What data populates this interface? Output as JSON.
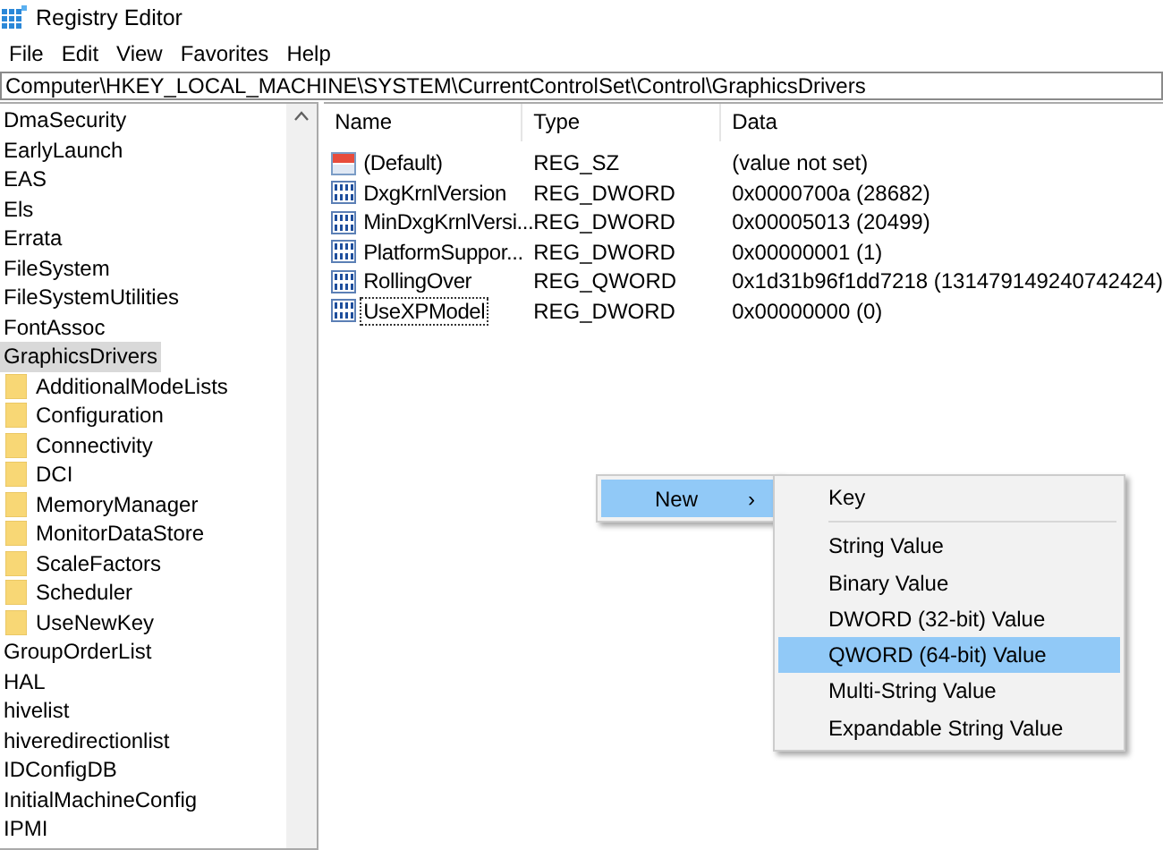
{
  "window": {
    "title": "Registry Editor"
  },
  "menu_bar": [
    "File",
    "Edit",
    "View",
    "Favorites",
    "Help"
  ],
  "address_bar": {
    "value": "Computer\\HKEY_LOCAL_MACHINE\\SYSTEM\\CurrentControlSet\\Control\\GraphicsDrivers"
  },
  "tree": [
    {
      "label": "DmaSecurity",
      "selected": false
    },
    {
      "label": "EarlyLaunch",
      "selected": false
    },
    {
      "label": "EAS",
      "selected": false
    },
    {
      "label": "Els",
      "selected": false
    },
    {
      "label": "Errata",
      "selected": false
    },
    {
      "label": "FileSystem",
      "selected": false
    },
    {
      "label": "FileSystemUtilities",
      "selected": false
    },
    {
      "label": "FontAssoc",
      "selected": false
    },
    {
      "label": "GraphicsDrivers",
      "selected": true,
      "children": [
        {
          "label": "AdditionalModeLists",
          "selected": false
        },
        {
          "label": "Configuration",
          "selected": false
        },
        {
          "label": "Connectivity",
          "selected": false
        },
        {
          "label": "DCI",
          "selected": false
        },
        {
          "label": "MemoryManager",
          "selected": false
        },
        {
          "label": "MonitorDataStore",
          "selected": false
        },
        {
          "label": "ScaleFactors",
          "selected": false
        },
        {
          "label": "Scheduler",
          "selected": false
        },
        {
          "label": "UseNewKey",
          "selected": false
        }
      ]
    },
    {
      "label": "GroupOrderList",
      "selected": false
    },
    {
      "label": "HAL",
      "selected": false
    },
    {
      "label": "hivelist",
      "selected": false
    },
    {
      "label": "hiveredirectionlist",
      "selected": false
    },
    {
      "label": "IDConfigDB",
      "selected": false
    },
    {
      "label": "InitialMachineConfig",
      "selected": false
    },
    {
      "label": "IPMI",
      "selected": false
    }
  ],
  "values_table": {
    "columns": [
      "Name",
      "Type",
      "Data"
    ],
    "rows": [
      {
        "kind": "string",
        "name": "(Default)",
        "type": "REG_SZ",
        "data": "(value not set)",
        "focused": false
      },
      {
        "kind": "binary",
        "name": "DxgKrnlVersion",
        "type": "REG_DWORD",
        "data": "0x0000700a (28682)",
        "focused": false
      },
      {
        "kind": "binary",
        "name": "MinDxgKrnlVersi...",
        "type": "REG_DWORD",
        "data": "0x00005013 (20499)",
        "focused": false
      },
      {
        "kind": "binary",
        "name": "PlatformSuppor...",
        "type": "REG_DWORD",
        "data": "0x00000001 (1)",
        "focused": false
      },
      {
        "kind": "binary",
        "name": "RollingOver",
        "type": "REG_QWORD",
        "data": "0x1d31b96f1dd7218 (131479149240742424)",
        "focused": false
      },
      {
        "kind": "binary",
        "name": "UseXPModel",
        "type": "REG_DWORD",
        "data": "0x00000000 (0)",
        "focused": true
      }
    ]
  },
  "context_menu": {
    "items": [
      {
        "label": "New",
        "arrow": "›",
        "selected": true
      }
    ]
  },
  "submenu": {
    "items": [
      {
        "kind": "item",
        "label": "Key",
        "selected": false
      },
      {
        "kind": "separator"
      },
      {
        "kind": "item",
        "label": "String Value",
        "selected": false
      },
      {
        "kind": "item",
        "label": "Binary Value",
        "selected": false
      },
      {
        "kind": "item",
        "label": "DWORD (32-bit) Value",
        "selected": false
      },
      {
        "kind": "item",
        "label": "QWORD (64-bit) Value",
        "selected": true
      },
      {
        "kind": "item",
        "label": "Multi-String Value",
        "selected": false
      },
      {
        "kind": "item",
        "label": "Expandable String Value",
        "selected": false
      }
    ]
  }
}
